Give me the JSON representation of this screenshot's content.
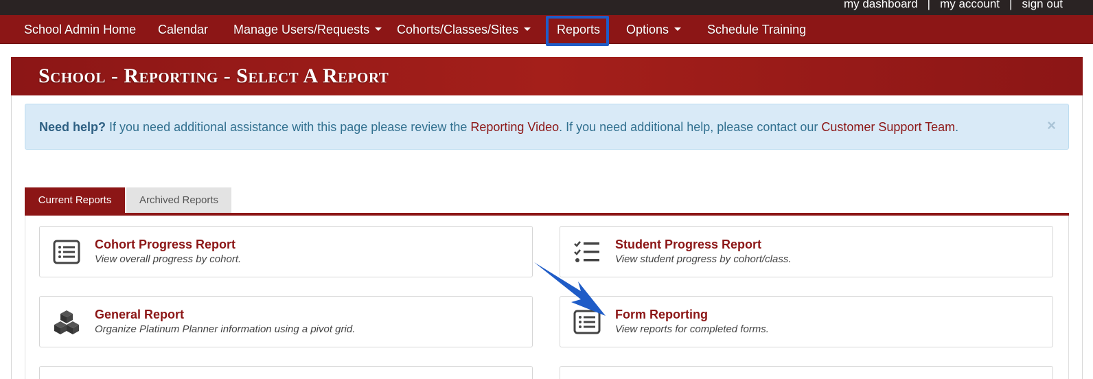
{
  "topbar": {
    "links": [
      "my dashboard",
      "my account",
      "sign out"
    ],
    "separator": "|"
  },
  "nav": {
    "items": [
      {
        "label": "School Admin Home",
        "dropdown": false
      },
      {
        "label": "Calendar",
        "dropdown": false
      },
      {
        "label": "Manage Users/Requests",
        "dropdown": true
      },
      {
        "label": "Cohorts/Classes/Sites",
        "dropdown": true
      },
      {
        "label": "Reports",
        "dropdown": false,
        "highlighted": true
      },
      {
        "label": "Options",
        "dropdown": true
      },
      {
        "label": "Schedule Training",
        "dropdown": false
      }
    ]
  },
  "page": {
    "title": "School - Reporting - Select A Report"
  },
  "help": {
    "lead": "Need help?",
    "text1": " If you need additional assistance with this page please review the ",
    "link1": "Reporting Video",
    "text2": ". If you need additional help, please contact our ",
    "link2": "Customer Support Team",
    "text3": ".",
    "close": "×"
  },
  "tabs": [
    {
      "label": "Current Reports",
      "active": true
    },
    {
      "label": "Archived Reports",
      "active": false
    }
  ],
  "reports": [
    {
      "title": "Cohort Progress Report",
      "desc": "View overall progress by cohort.",
      "icon": "list-alt-icon"
    },
    {
      "title": "Student Progress Report",
      "desc": "View student progress by cohort/class.",
      "icon": "checklist-icon"
    },
    {
      "title": "General Report",
      "desc": "Organize Platinum Planner information using a pivot grid.",
      "icon": "cubes-icon"
    },
    {
      "title": "Form Reporting",
      "desc": "View reports for completed forms.",
      "icon": "list-alt-icon"
    }
  ],
  "colors": {
    "brand": "#8c1616",
    "topbar": "#2a2323",
    "highlight": "#1f5cc7",
    "alert_bg": "#d9eaf7",
    "alert_text": "#31708f"
  }
}
